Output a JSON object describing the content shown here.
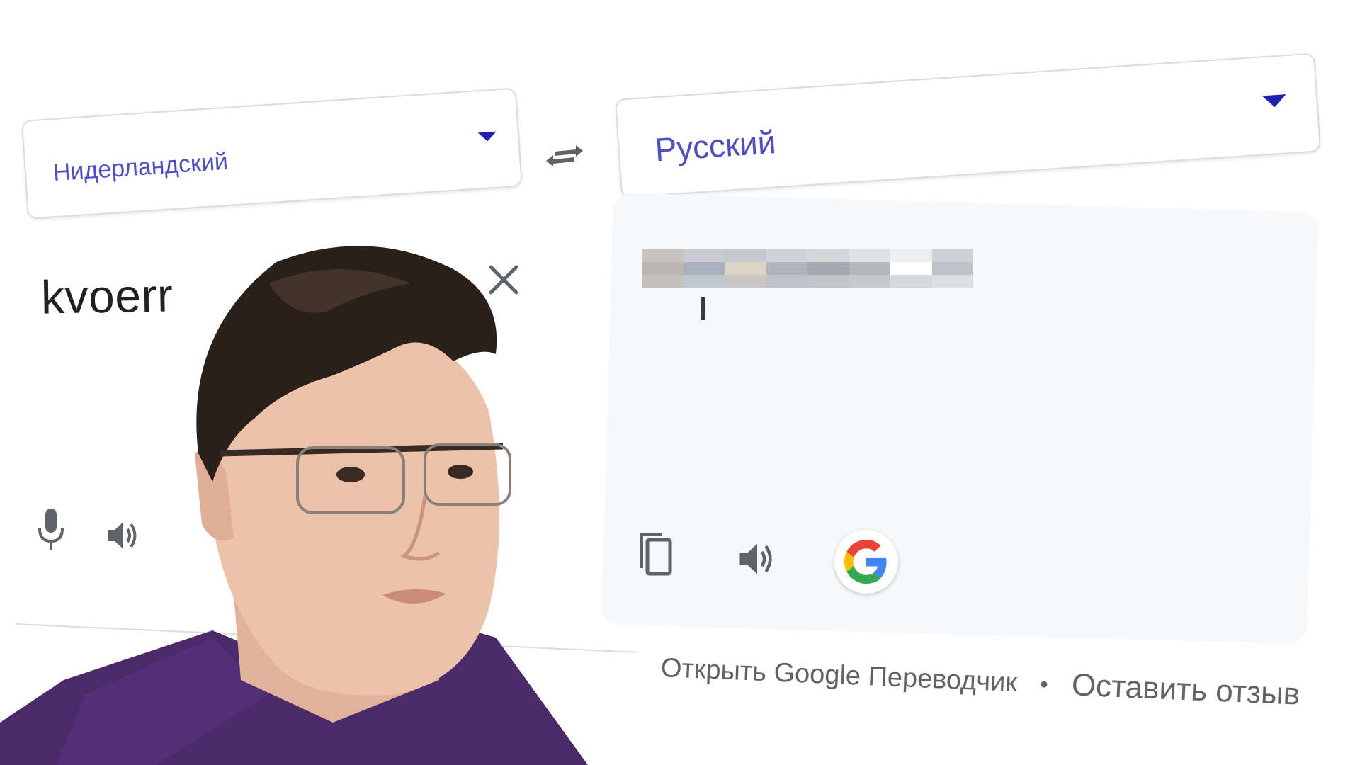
{
  "source_language": {
    "label": "Нидерландский"
  },
  "target_language": {
    "label": "Русский"
  },
  "source": {
    "text": "kvoerr"
  },
  "target": {
    "text": ""
  },
  "footer": {
    "open_translator": "Открыть Google Переводчик",
    "separator": "•",
    "feedback": "Оставить отзыв"
  },
  "icons": {
    "swap": "swap-arrows-icon",
    "clear": "close-icon",
    "mic": "microphone-icon",
    "source_speaker": "speaker-icon",
    "copy": "copy-icon",
    "target_speaker": "speaker-icon",
    "google": "google-logo-icon"
  },
  "colors": {
    "language_text": "#4f4fc4",
    "caret": "#1f1fb0",
    "text": "#202124",
    "muted": "#5f6368",
    "panel": "#f7f8fa",
    "border": "#dadce0",
    "google_blue": "#4285F4",
    "google_red": "#EA4335",
    "google_yellow": "#FBBC05",
    "google_green": "#34A853"
  },
  "overlay": {
    "type": "webcam-person",
    "shirt_color": "#4a2a68"
  }
}
